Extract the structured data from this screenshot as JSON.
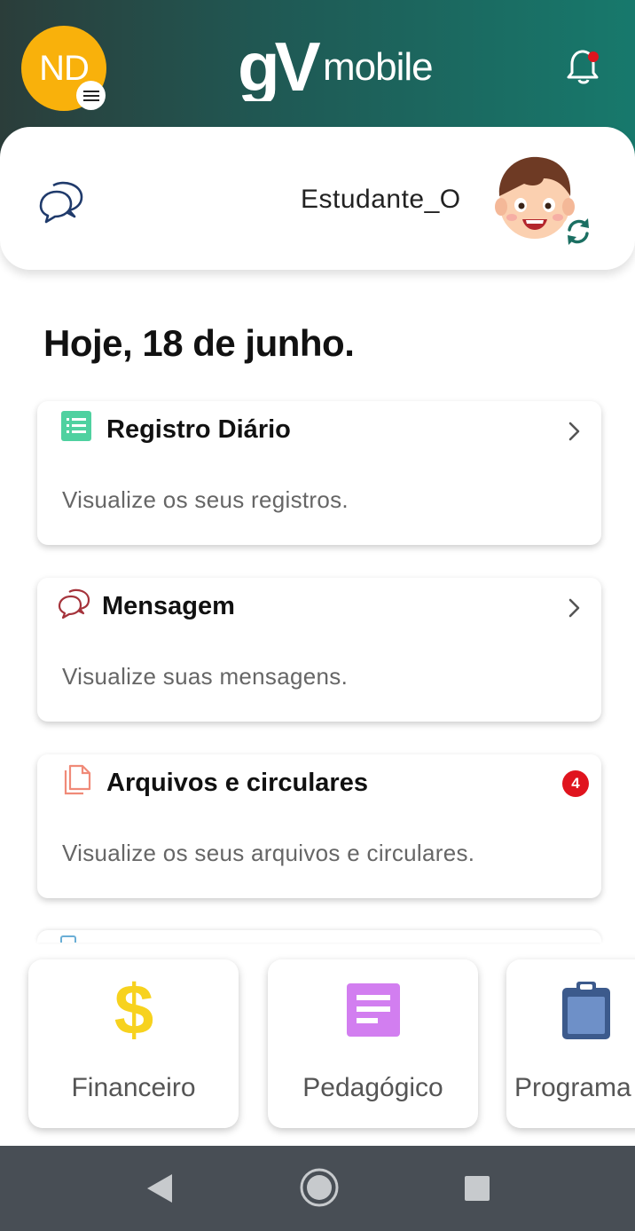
{
  "header": {
    "avatar_initials": "ND",
    "menu_icon": "hamburger-menu-icon",
    "logo_text": {
      "gv": "gV",
      "mobile": "mobile"
    },
    "notification_icon": "bell-icon",
    "notification_dot_color": "#e0141e"
  },
  "profile": {
    "chat_icon": "chat-bubbles-icon",
    "student_name": "Estudante_O",
    "switch_icon": "sync-icon"
  },
  "date_title": "Hoje, 18 de junho.",
  "cards": [
    {
      "title": "Registro Diário",
      "description": "Visualize os seus registros.",
      "icon": "list-icon",
      "icon_color": "#4fd1a0",
      "action": "chevron-right-icon"
    },
    {
      "title": "Mensagem",
      "description": "Visualize suas mensagens.",
      "icon": "message-bubbles-icon",
      "icon_color": "#a5333b",
      "action": "chevron-right-icon"
    },
    {
      "title": "Arquivos e circulares",
      "description": "Visualize os seus arquivos e circulares.",
      "icon": "files-icon",
      "icon_color": "#f08a78",
      "badge": "4"
    }
  ],
  "tiles": [
    {
      "label": "Financeiro",
      "icon": "dollar-icon",
      "icon_color": "#f7d21e"
    },
    {
      "label": "Pedagógico",
      "icon": "document-icon",
      "icon_color": "#d27ef0"
    },
    {
      "label": "Programa",
      "icon": "clipboard-icon",
      "icon_color": "#3c5a8c"
    }
  ],
  "navbar": {
    "back_icon": "back-triangle-icon",
    "home_icon": "home-circle-icon",
    "recents_icon": "recents-square-icon"
  }
}
